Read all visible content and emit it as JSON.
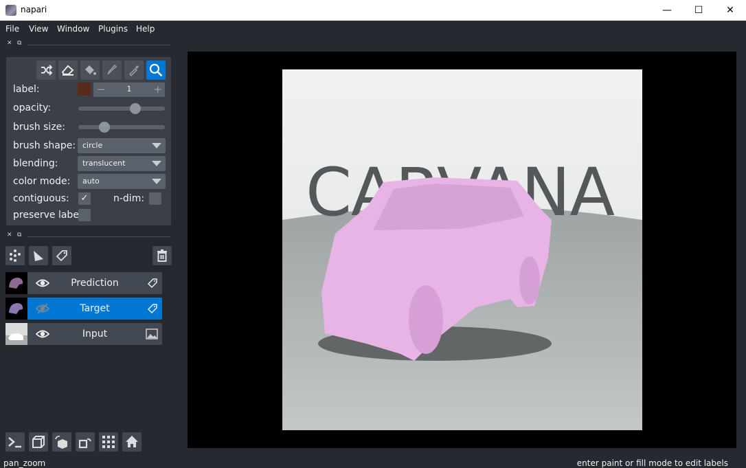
{
  "window": {
    "title": "napari",
    "minimize": "—",
    "maximize": "☐",
    "close": "✕"
  },
  "menu": [
    "File",
    "View",
    "Window",
    "Plugins",
    "Help"
  ],
  "dock": {
    "close": "✕",
    "float": "⧉"
  },
  "controls": {
    "label_label": "label:",
    "label_value": "1",
    "label_color": "#5a2a1c",
    "minus": "−",
    "plus": "+",
    "opacity_label": "opacity:",
    "opacity_value": 0.68,
    "brush_size_label": "brush size:",
    "brush_size_value": 0.27,
    "brush_shape_label": "brush shape:",
    "brush_shape": "circle",
    "blending_label": "blending:",
    "blending": "translucent",
    "color_mode_label": "color mode:",
    "color_mode": "auto",
    "contiguous_label": "contiguous:",
    "contiguous_check": "✓",
    "ndim_label": "n-dim:",
    "preserve_label": "preserve labels"
  },
  "layers": [
    {
      "name": "Prediction",
      "type": "labels",
      "visible": true,
      "selected": false
    },
    {
      "name": "Target",
      "type": "labels",
      "visible": false,
      "selected": true
    },
    {
      "name": "Input",
      "type": "image",
      "visible": true,
      "selected": false
    }
  ],
  "canvas": {
    "image_text": "CARVANA",
    "label_color": "#e8b4e6"
  },
  "status": {
    "left": "pan_zoom",
    "right": "enter paint or fill mode to edit labels"
  },
  "colors": {
    "bg": "#262930",
    "accent": "#0078d4"
  }
}
